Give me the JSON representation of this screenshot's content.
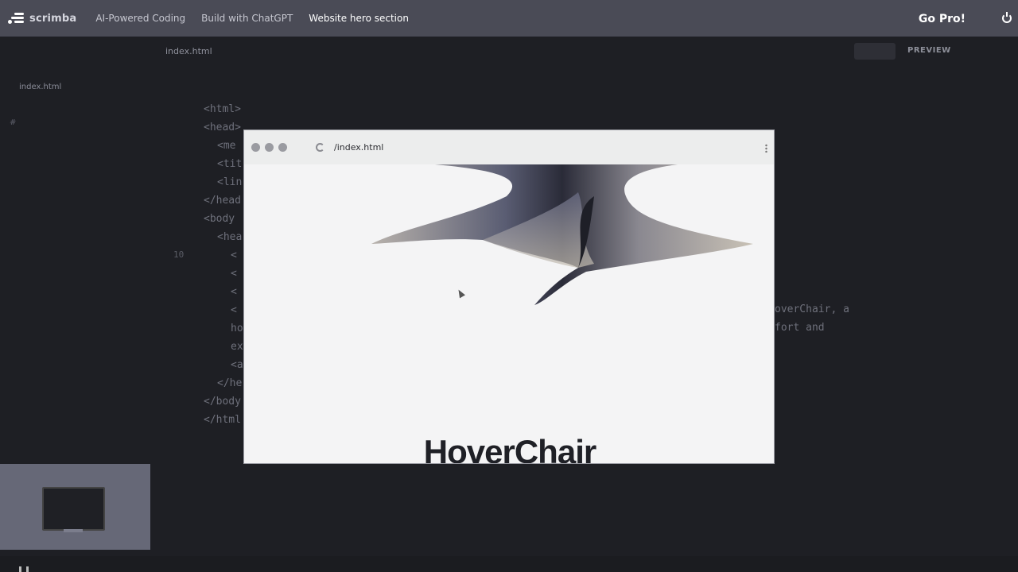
{
  "brand": {
    "name": "scrimba",
    "icon": "scrimba-logo-icon"
  },
  "breadcrumbs": [
    {
      "label": "AI-Powered Coding"
    },
    {
      "label": "Build with ChatGPT"
    },
    {
      "label": "Website hero section"
    }
  ],
  "header": {
    "cta_label": "Go Pro!",
    "power_icon": "power-icon"
  },
  "sidebar": {
    "files": [
      {
        "label": "index.html"
      }
    ],
    "hash_label": "#"
  },
  "editor": {
    "tab_label": "index.html",
    "preview_label": "PREVIEW",
    "line_number": "10",
    "code_lines": [
      "<html>",
      "<head>",
      "<me",
      "<tit",
      "<lin",
      "</head",
      "<body",
      "<hea",
      "<",
      "<",
      "<",
      "<",
      "ho",
      "ex",
      "<a",
      "</he",
      "</body",
      "</html"
    ],
    "overflow_text": [
      "overChair, a",
      "fort and"
    ]
  },
  "preview": {
    "url": "/index.html",
    "hero_title": "HoverChair",
    "icons": [
      "reload-icon",
      "kebab-icon",
      "cursor-icon"
    ]
  },
  "colors": {
    "topbar": "#4a4b56",
    "editor_bg": "#1e1f24",
    "preview_bg": "#f4f4f5"
  }
}
